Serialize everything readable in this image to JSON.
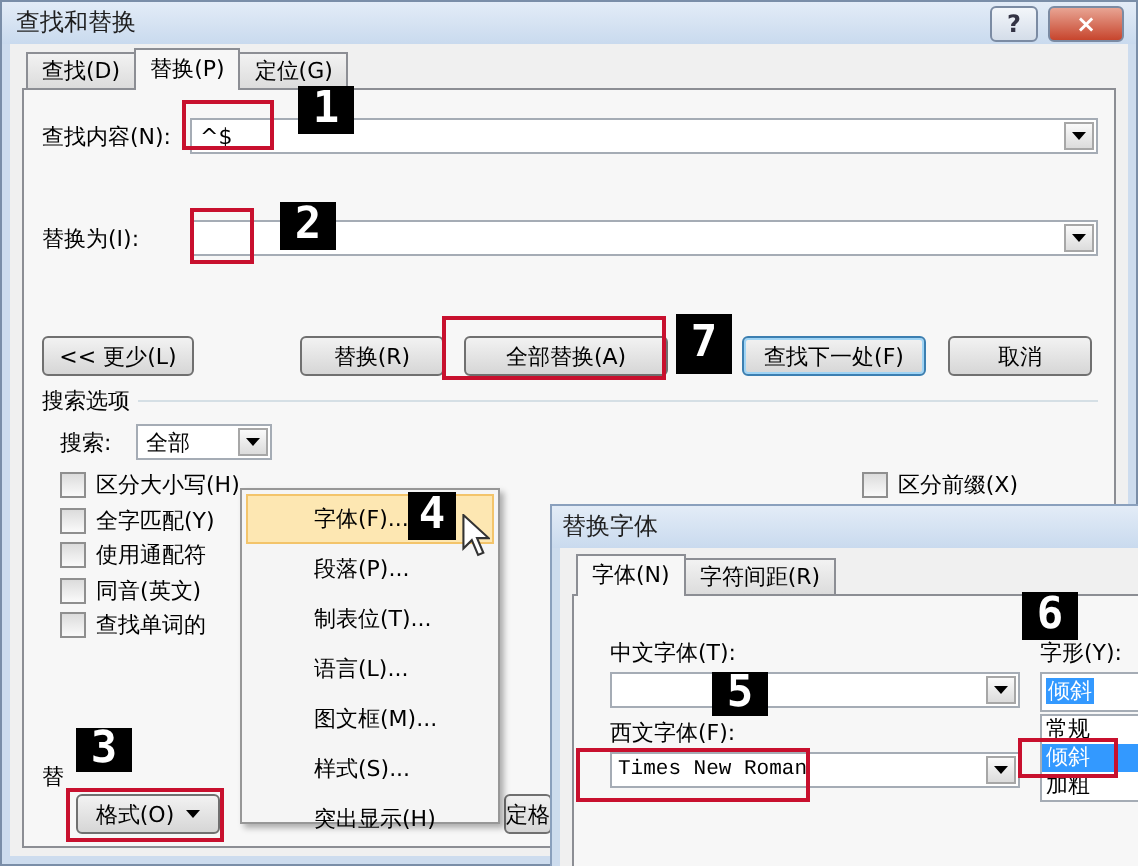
{
  "window": {
    "title": "查找和替换",
    "help": "?",
    "close": "×"
  },
  "tabs": [
    {
      "label": "查找(D)",
      "selected": false
    },
    {
      "label": "替换(P)",
      "selected": true
    },
    {
      "label": "定位(G)",
      "selected": false
    }
  ],
  "find": {
    "label": "查找内容(N):",
    "value": "^$"
  },
  "replace": {
    "label": "替换为(I):"
  },
  "buttons": [
    {
      "label": "<< 更少(L)",
      "default": false
    },
    {
      "label": "替换(R)",
      "default": false
    },
    {
      "label": "全部替换(A)",
      "default": false
    },
    {
      "label": "查找下一处(F)",
      "default": true
    },
    {
      "label": "取消",
      "default": false
    }
  ],
  "search_options": {
    "title": "搜索选项",
    "search_label": "搜索:",
    "search_value": "全部",
    "left_checkboxes": [
      {
        "label": "区分大小写(H)",
        "checked": false
      },
      {
        "label": "全字匹配(Y)",
        "checked": false
      },
      {
        "label": "使用通配符",
        "checked": false
      },
      {
        "label": "同音(英文)",
        "checked": false
      },
      {
        "label": "查找单词的",
        "checked": false
      }
    ],
    "right_checkboxes": [
      {
        "label": "区分前缀(X)",
        "checked": false
      }
    ]
  },
  "replace_section": {
    "label": "替",
    "format_button": "格式(O)",
    "partial_button": "定格"
  },
  "format_menu": {
    "items": [
      {
        "label": "字体(F)...",
        "selected": true
      },
      {
        "label": "段落(P)...",
        "selected": false
      },
      {
        "label": "制表位(T)...",
        "selected": false
      },
      {
        "label": "语言(L)...",
        "selected": false
      },
      {
        "label": "图文框(M)...",
        "selected": false
      },
      {
        "label": "样式(S)...",
        "selected": false
      },
      {
        "label": "突出显示(H)",
        "selected": false
      }
    ]
  },
  "font_dialog": {
    "title": "替换字体",
    "tabs": [
      {
        "label": "字体(N)",
        "selected": true
      },
      {
        "label": "字符间距(R)",
        "selected": false
      }
    ],
    "cn_font_label": "中文字体(T):",
    "west_font_label": "西文字体(F):",
    "west_font_value": "Times New Roman",
    "style_label": "字形(Y):",
    "style_value": "倾斜",
    "style_options": [
      {
        "label": "常规",
        "selected": false
      },
      {
        "label": "倾斜",
        "selected": true
      },
      {
        "label": "加粗",
        "selected": false
      }
    ]
  },
  "annotations": [
    {
      "number": "1"
    },
    {
      "number": "2"
    },
    {
      "number": "3"
    },
    {
      "number": "4"
    },
    {
      "number": "5"
    },
    {
      "number": "6"
    },
    {
      "number": "7"
    }
  ]
}
